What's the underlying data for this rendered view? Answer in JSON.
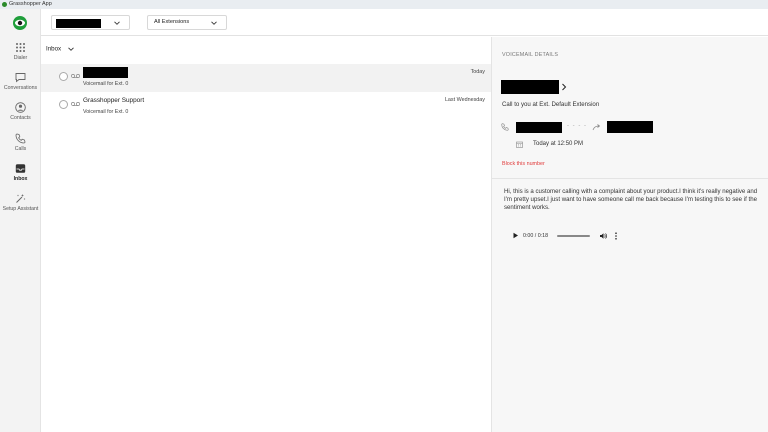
{
  "window": {
    "title": "Grasshopper App"
  },
  "sidebar": {
    "items": [
      {
        "label": "Dialer",
        "icon": "dialpad-icon"
      },
      {
        "label": "Conversations",
        "icon": "chat-icon"
      },
      {
        "label": "Contacts",
        "icon": "contact-icon"
      },
      {
        "label": "Calls",
        "icon": "phone-icon"
      },
      {
        "label": "Inbox",
        "icon": "inbox-icon",
        "active": true
      },
      {
        "label": "Setup Assistant",
        "icon": "magic-wand-icon"
      }
    ]
  },
  "topbar": {
    "number_selector": {
      "value": ""
    },
    "extension_selector": {
      "value": "All Extensions"
    }
  },
  "inbox": {
    "filter_label": "Inbox",
    "rows": [
      {
        "caller": "",
        "subtitle": "Voicemail for Ext. 0",
        "date": "Today",
        "selected": true
      },
      {
        "caller": "Grasshopper Support",
        "subtitle": "Voicemail for Ext. 0",
        "date": "Last Wednesday",
        "selected": false
      }
    ]
  },
  "detail": {
    "header": "VOICEMAIL DETAILS",
    "call_to": "Call to you at Ext. Default Extension",
    "dashes": "- - - -",
    "timestamp": "Today at 12:50 PM",
    "block_label": "Block this number",
    "transcript": "Hi, this is a customer calling with a complaint about your product.I think it's really negative and I'm pretty upset.I just want to have someone call me back because I'm testing this to see if the sentiment works.",
    "player": {
      "time": "0:00 / 0:18",
      "progress": 0
    }
  },
  "colors": {
    "accent": "#2a8a2a",
    "danger": "#e03a3a"
  }
}
